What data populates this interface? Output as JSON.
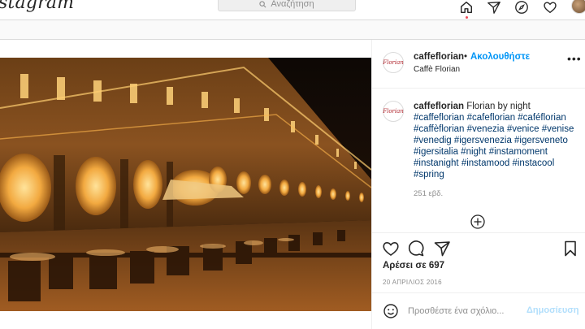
{
  "nav": {
    "logo_text": "Instagram",
    "search_placeholder": "Αναζήτηση"
  },
  "post": {
    "username": "caffeflorian",
    "separator": "•",
    "follow_label": "Ακολουθήστε",
    "location": "Caffè Florian",
    "avatar_label": "Florian",
    "more_label": "•••",
    "caption_text": "Florian by night",
    "hashtags": "#caffeflorian #cafeflorian #caféflorian #caffèflorian #venezia #venice #venise #venedig #igersvenezia #igersveneto #igersitalia #night #instamoment #instanight #instamood #instacool #spring",
    "caption_age": "251 εβδ.",
    "likes_text": "Αρέσει σε 697",
    "date_text": "20 ΑΠΡΙΛΙΟΣ 2016",
    "comment_placeholder": "Προσθέστε ένα σχόλιο...",
    "post_button": "Δημοσίευση"
  },
  "colors": {
    "link_blue": "#0095f6",
    "hashtag_blue": "#00376b",
    "notification_red": "#ed4956",
    "post_disabled": "#b2dffc"
  },
  "icons": [
    "search-icon",
    "home-icon",
    "direct-icon",
    "explore-icon",
    "heart-icon",
    "like-icon",
    "comment-icon",
    "share-icon",
    "save-icon",
    "emoji-icon",
    "load-more-icon",
    "more-options-icon"
  ]
}
